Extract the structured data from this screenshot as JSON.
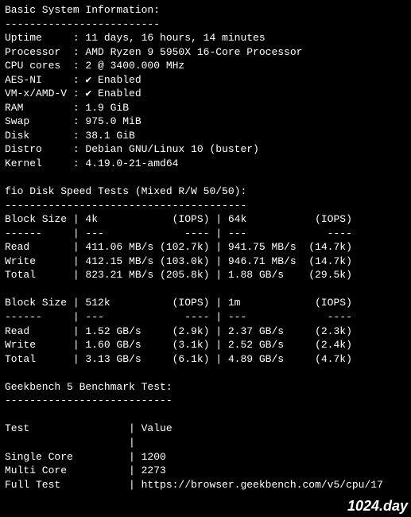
{
  "watermark": "1024.day",
  "sysinfo": {
    "title": "Basic System Information:",
    "rows": [
      {
        "label": "Uptime",
        "value": "11 days, 16 hours, 14 minutes"
      },
      {
        "label": "Processor",
        "value": "AMD Ryzen 9 5950X 16-Core Processor"
      },
      {
        "label": "CPU cores",
        "value": "2 @ 3400.000 MHz"
      },
      {
        "label": "AES-NI",
        "value": "✔ Enabled"
      },
      {
        "label": "VM-x/AMD-V",
        "value": "✔ Enabled"
      },
      {
        "label": "RAM",
        "value": "1.9 GiB"
      },
      {
        "label": "Swap",
        "value": "975.0 MiB"
      },
      {
        "label": "Disk",
        "value": "38.1 GiB"
      },
      {
        "label": "Distro",
        "value": "Debian GNU/Linux 10 (buster)"
      },
      {
        "label": "Kernel",
        "value": "4.19.0-21-amd64"
      }
    ]
  },
  "fio": {
    "title": "fio Disk Speed Tests (Mixed R/W 50/50):",
    "header": {
      "col0": "Block Size",
      "iops": "(IOPS)"
    },
    "rowlabels": {
      "read": "Read",
      "write": "Write",
      "total": "Total"
    },
    "groups": [
      {
        "left": {
          "size": "4k",
          "read": {
            "speed": "411.06 MB/s",
            "iops": "(102.7k)"
          },
          "write": {
            "speed": "412.15 MB/s",
            "iops": "(103.0k)"
          },
          "total": {
            "speed": "823.21 MB/s",
            "iops": "(205.8k)"
          }
        },
        "right": {
          "size": "64k",
          "read": {
            "speed": "941.75 MB/s",
            "iops": "(14.7k)"
          },
          "write": {
            "speed": "946.71 MB/s",
            "iops": "(14.7k)"
          },
          "total": {
            "speed": "1.88 GB/s",
            "iops": "(29.5k)"
          }
        }
      },
      {
        "left": {
          "size": "512k",
          "read": {
            "speed": "1.52 GB/s",
            "iops": "(2.9k)"
          },
          "write": {
            "speed": "1.60 GB/s",
            "iops": "(3.1k)"
          },
          "total": {
            "speed": "3.13 GB/s",
            "iops": "(6.1k)"
          }
        },
        "right": {
          "size": "1m",
          "read": {
            "speed": "2.37 GB/s",
            "iops": "(2.3k)"
          },
          "write": {
            "speed": "2.52 GB/s",
            "iops": "(2.4k)"
          },
          "total": {
            "speed": "4.89 GB/s",
            "iops": "(4.7k)"
          }
        }
      }
    ]
  },
  "geekbench": {
    "title": "Geekbench 5 Benchmark Test:",
    "header": {
      "test": "Test",
      "value": "Value"
    },
    "rows": [
      {
        "label": "Single Core",
        "value": "1200"
      },
      {
        "label": "Multi Core",
        "value": "2273"
      },
      {
        "label": "Full Test",
        "value": "https://browser.geekbench.com/v5/cpu/17"
      }
    ]
  },
  "chart_data": {
    "type": "table",
    "tables": [
      {
        "name": "fio Disk Speed Tests (Mixed R/W 50/50)",
        "block_sizes": [
          "4k",
          "64k",
          "512k",
          "1m"
        ],
        "measurements": [
          {
            "op": "Read",
            "values": [
              "411.06 MB/s (102.7k IOPS)",
              "941.75 MB/s (14.7k IOPS)",
              "1.52 GB/s (2.9k IOPS)",
              "2.37 GB/s (2.3k IOPS)"
            ]
          },
          {
            "op": "Write",
            "values": [
              "412.15 MB/s (103.0k IOPS)",
              "946.71 MB/s (14.7k IOPS)",
              "1.60 GB/s (3.1k IOPS)",
              "2.52 GB/s (2.4k IOPS)"
            ]
          },
          {
            "op": "Total",
            "values": [
              "823.21 MB/s (205.8k IOPS)",
              "1.88 GB/s (29.5k IOPS)",
              "3.13 GB/s (6.1k IOPS)",
              "4.89 GB/s (4.7k IOPS)"
            ]
          }
        ]
      },
      {
        "name": "Geekbench 5 Benchmark Test",
        "rows": [
          {
            "test": "Single Core",
            "value": 1200
          },
          {
            "test": "Multi Core",
            "value": 2273
          }
        ]
      }
    ]
  }
}
